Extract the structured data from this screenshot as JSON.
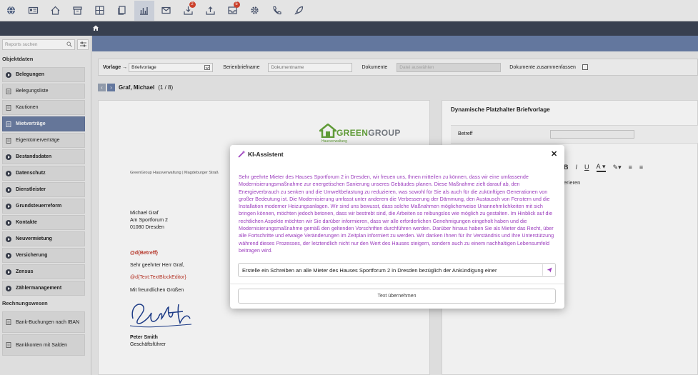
{
  "toolbar": {
    "items": [
      {
        "icon": "globe-icon"
      },
      {
        "icon": "id-card-icon"
      },
      {
        "icon": "house-icon"
      },
      {
        "icon": "archive-icon"
      },
      {
        "icon": "grid-icon"
      },
      {
        "icon": "documents-icon"
      },
      {
        "icon": "chart-icon",
        "active": true
      },
      {
        "icon": "mail-icon"
      },
      {
        "icon": "download-tray-icon",
        "badge": "2"
      },
      {
        "icon": "upload-tray-icon"
      },
      {
        "icon": "inbox-icon",
        "badge": "5"
      },
      {
        "icon": "gear-icon"
      },
      {
        "icon": "phone-icon"
      },
      {
        "icon": "rocket-icon"
      }
    ]
  },
  "sidebar": {
    "search_placeholder": "Reports suchen",
    "section1": "Objektdaten",
    "section2": "Rechnungswesen",
    "items": [
      {
        "label": "Belegungen",
        "kind": "group"
      },
      {
        "label": "Belegungsliste",
        "kind": "doc"
      },
      {
        "label": "Kautionen",
        "kind": "doc"
      },
      {
        "label": "Mietverträge",
        "kind": "active"
      },
      {
        "label": "Eigentümerverträge",
        "kind": "doc"
      },
      {
        "label": "Bestandsdaten",
        "kind": "group"
      },
      {
        "label": "Datenschutz",
        "kind": "group"
      },
      {
        "label": "Dienstleister",
        "kind": "group"
      },
      {
        "label": "Grundsteuerreform",
        "kind": "group"
      },
      {
        "label": "Kontakte",
        "kind": "group"
      },
      {
        "label": "Neuvermietung",
        "kind": "group"
      },
      {
        "label": "Versicherung",
        "kind": "group"
      },
      {
        "label": "Zensus",
        "kind": "group"
      },
      {
        "label": "Zählermanagement",
        "kind": "group"
      }
    ],
    "items2": [
      {
        "label": "Bank-Buchungen nach IBAN",
        "kind": "doc"
      },
      {
        "label": "Bankkonten mit Salden",
        "kind": "doc"
      }
    ]
  },
  "options": {
    "vorlage_label": "Vorlage →",
    "vorlage_value": "Briefvorlage",
    "serienbriefname_label": "Serienbriefname",
    "dokumentname_placeholder": "Dokumentname",
    "dokumente_label": "Dokumente",
    "datei_placeholder": "Datei auswählen",
    "zusammenfassen_label": "Dokumente zusammenfassen"
  },
  "record": {
    "name": "Graf, Michael",
    "counter": "(1 / 8)"
  },
  "letter": {
    "logo_green": "GREEN",
    "logo_grey": "GROUP",
    "logo_sub": "Hausverwaltung",
    "sender_line": "GreenGroup Hausverwaltung | Magdeburger Straß",
    "recipient": [
      "Michael Graf",
      "Am Sportforum 2",
      "01080 Dresden"
    ],
    "token_betreff": "@d{Betreff}",
    "salutation": "Sehr geehrter Herr Graf,",
    "token_text": "@d{Text:TextBlockEditor}",
    "closing": "Mit freundlichen Grüßen",
    "sign_name": "Peter Smith",
    "sign_title": "Geschäftsführer"
  },
  "right_panel": {
    "title": "Dynamische Platzhalter Briefvorlage",
    "betreff_label": "Betreff",
    "fmt": [
      "B",
      "I",
      "U",
      "A",
      "≡",
      "≡"
    ],
    "text_partial": "erieren"
  },
  "modal": {
    "title": "KI-Assistent",
    "body": "Sehr geehrte Mieter des Hauses Sportforum 2 in Dresden, wir freuen uns, Ihnen mitteilen zu können, dass wir eine umfassende Modernisierungsmaßnahme zur energetischen Sanierung unseres Gebäudes planen. Diese Maßnahme zielt darauf ab, den Energieverbrauch zu senken und die Umweltbelastung zu reduzieren, was sowohl für Sie als auch für die zukünftigen Generationen von großer Bedeutung ist. Die Modernisierung umfasst unter anderem die Verbesserung der Dämmung, den Austausch von Fenstern und die Installation moderner Heizungsanlagen. Wir sind uns bewusst, dass solche Maßnahmen möglicherweise Unannehmlichkeiten mit sich bringen können, möchten jedoch betonen, dass wir bestrebt sind, die Arbeiten so reibungslos wie möglich zu gestalten. Im Hinblick auf die rechtlichen Aspekte möchten wir Sie darüber informieren, dass wir alle erforderlichen Genehmigungen eingeholt haben und die Modernisierungsmaßnahme gemäß den geltenden Vorschriften durchführen werden. Darüber hinaus haben Sie als Mieter das Recht, über alle Fortschritte und etwaige Veränderungen im Zeitplan informiert zu werden. Wir danken Ihnen für Ihr Verständnis und Ihre Unterstützung während dieses Prozesses, der letztendlich nicht nur den Wert des Hauses steigern, sondern auch zu einem nachhaltigen Lebensumfeld beitragen wird.",
    "prompt_value": "Erstelle ein Schreiben an alle Mieter des Hauses Sportforum 2 in Dresden bezüglich der Ankündigung einer",
    "apply_label": "Text übernehmen"
  },
  "colors": {
    "accent": "#6a7fa8",
    "ai_text": "#9b3dbd",
    "token": "#c0392b",
    "brand_green": "#67a53c"
  }
}
